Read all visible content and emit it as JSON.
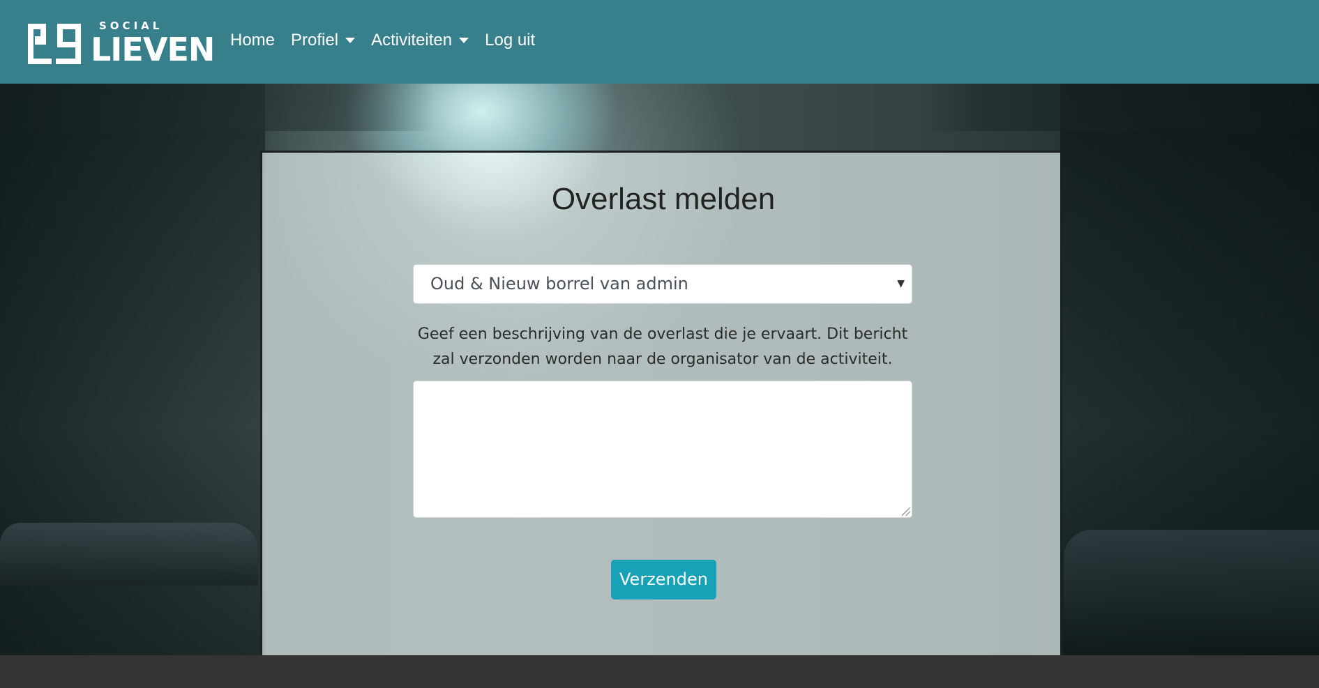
{
  "logo": {
    "top_text": "SOCIAL",
    "main_text": "LIEVEN"
  },
  "nav": {
    "home": "Home",
    "profiel": "Profiel",
    "activiteiten": "Activiteiten",
    "logout": "Log uit"
  },
  "page": {
    "title": "Overlast melden",
    "select_value": "Oud & Nieuw borrel van admin",
    "description": "Geef een beschrijving van de overlast die je ervaart. Dit bericht zal verzonden worden naar de organisator van de activiteit.",
    "textarea_value": "",
    "submit_label": "Verzenden"
  },
  "colors": {
    "navbar": "#367f8b",
    "button": "#17a2b8",
    "footer": "#343434"
  }
}
